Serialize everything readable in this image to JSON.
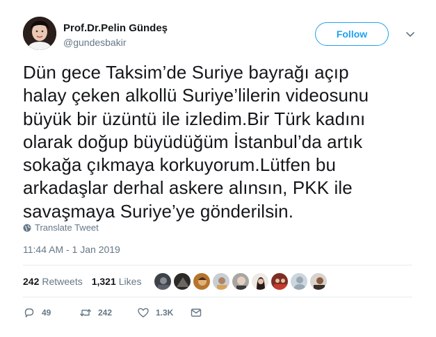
{
  "user": {
    "display_name": "Prof.Dr.Pelin Gündeş",
    "handle": "@gundesbakir"
  },
  "follow_label": "Follow",
  "tweet": {
    "lines": [
      "Dün gece Taksim’de Suriye bayrağı açıp",
      "halay çeken alkollü Suriye’lilerin videosunu",
      "büyük bir üzüntü ile izledim.Bir Türk kadını",
      "olarak doğup büyüdüğüm İstanbul’da artık",
      "sokağa çıkmaya korkuyorum.Lütfen bu",
      "arkadaşlar derhal askere alınsın, PKK ile",
      "savaşmaya Suriye’ye gönderilsin."
    ]
  },
  "translate_label": "Translate Tweet",
  "timestamp": "11:44 AM - 1 Jan 2019",
  "stats": {
    "retweets_count": "242",
    "retweets_label": "Retweets",
    "likes_count": "1,321",
    "likes_label": "Likes"
  },
  "actions": {
    "replies": "49",
    "retweets": "242",
    "likes": "1.3K"
  },
  "colors": {
    "accent": "#1da1f2",
    "secondary_text": "#657786",
    "divider": "#e6ecf0"
  }
}
